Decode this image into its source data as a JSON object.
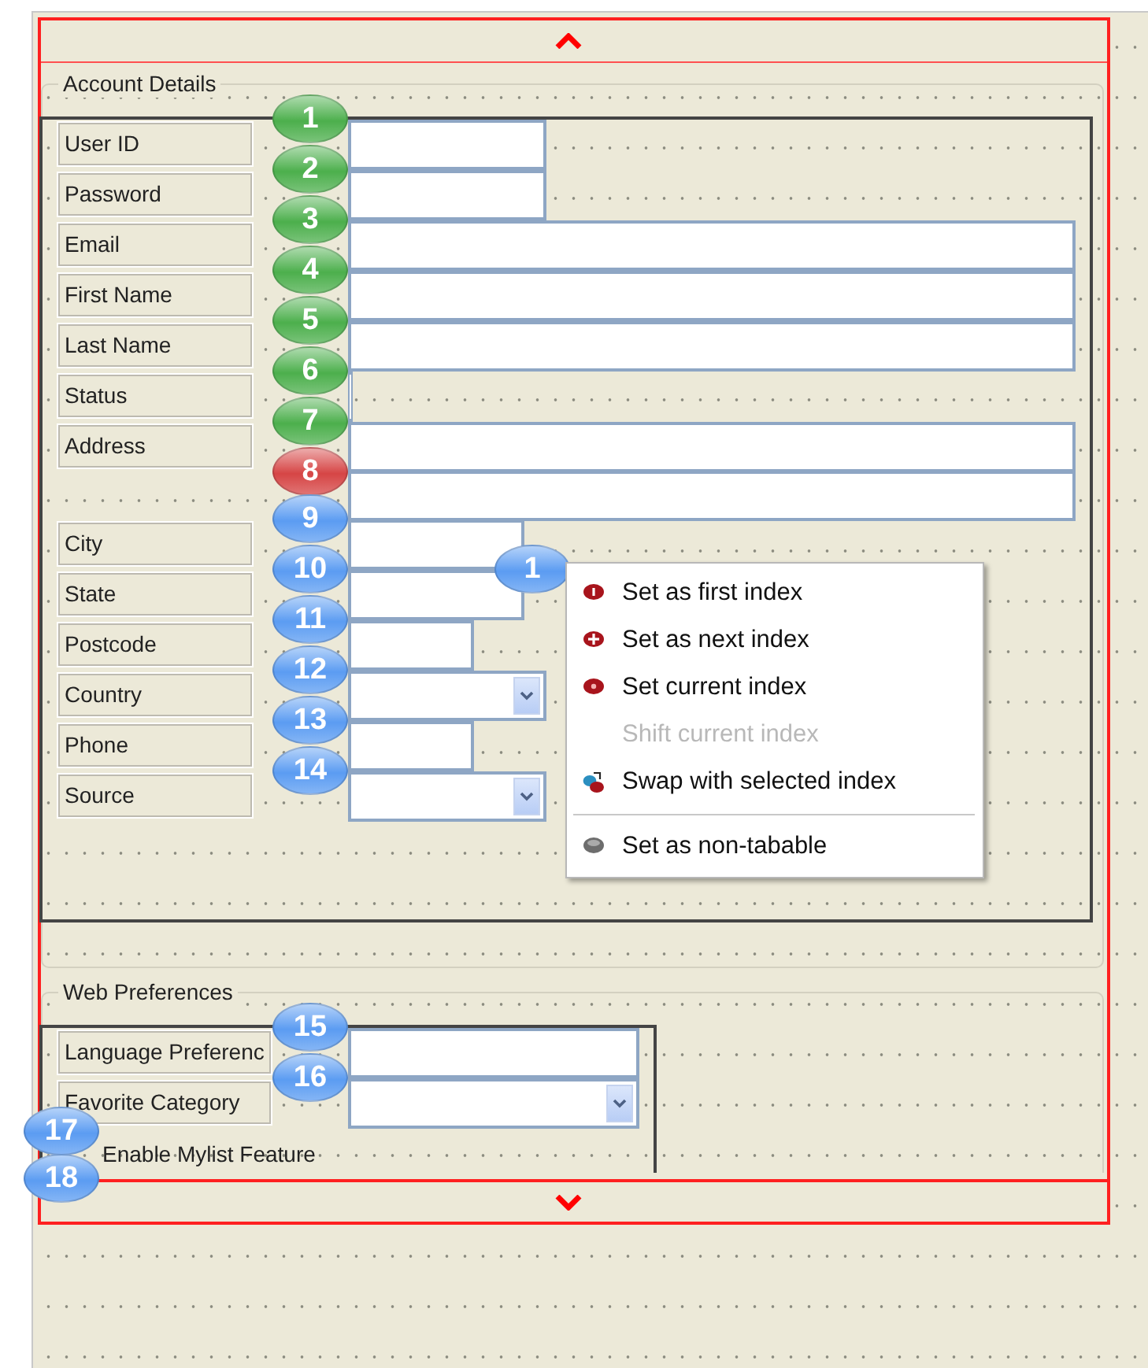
{
  "design_canvas": {
    "groups": [
      {
        "title": "Account Details",
        "rows": [
          {
            "label": "User ID",
            "fields": [
              {
                "kind": "short",
                "badge": {
                  "number": "1",
                  "color": "#4caf4c"
                }
              }
            ]
          },
          {
            "label": "Password",
            "fields": [
              {
                "kind": "short",
                "badge": {
                  "number": "2",
                  "color": "#4caf4c"
                }
              }
            ]
          },
          {
            "label": "Email",
            "fields": [
              {
                "kind": "long",
                "badge": {
                  "number": "3",
                  "color": "#4caf4c"
                }
              }
            ]
          },
          {
            "label": "First Name",
            "fields": [
              {
                "kind": "long",
                "badge": {
                  "number": "4",
                  "color": "#4caf4c"
                }
              }
            ]
          },
          {
            "label": "Last Name",
            "fields": [
              {
                "kind": "long",
                "badge": {
                  "number": "5",
                  "color": "#4caf4c"
                }
              }
            ]
          },
          {
            "label": "Status",
            "fields": [
              {
                "kind": "stub",
                "badge": {
                  "number": "6",
                  "color": "#4caf4c"
                }
              }
            ]
          },
          {
            "label": "Address",
            "fields": [
              {
                "kind": "long",
                "badge": {
                  "number": "7",
                  "color": "#4caf4c"
                }
              },
              {
                "kind": "long",
                "badge": {
                  "number": "8",
                  "color": "#d64545"
                }
              }
            ]
          },
          {
            "label": "City",
            "fields": [
              {
                "kind": "short",
                "badge": {
                  "number": "9",
                  "color": "#5b9cf2"
                }
              }
            ]
          },
          {
            "label": "State",
            "fields": [
              {
                "kind": "short",
                "badge": {
                  "number": "10",
                  "color": "#5b9cf2"
                }
              }
            ],
            "covered_badge": {
              "number": "1",
              "color": "#5b9cf2"
            }
          },
          {
            "label": "Postcode",
            "fields": [
              {
                "kind": "medium",
                "badge": {
                  "number": "11",
                  "color": "#5b9cf2"
                }
              }
            ]
          },
          {
            "label": "Country",
            "fields": [
              {
                "kind": "dropdown",
                "badge": {
                  "number": "12",
                  "color": "#5b9cf2"
                }
              }
            ]
          },
          {
            "label": "Phone",
            "fields": [
              {
                "kind": "medium",
                "badge": {
                  "number": "13",
                  "color": "#5b9cf2"
                }
              }
            ]
          },
          {
            "label": "Source",
            "fields": [
              {
                "kind": "dropdown",
                "badge": {
                  "number": "14",
                  "color": "#5b9cf2"
                }
              }
            ]
          }
        ]
      },
      {
        "title": "Web Preferences",
        "rows": [
          {
            "label": "Language Preferenc",
            "fields": [
              {
                "kind": "wide",
                "badge": {
                  "number": "15",
                  "color": "#5b9cf2"
                }
              }
            ]
          },
          {
            "label": "Favorite Category",
            "fields": [
              {
                "kind": "widedropdown",
                "badge": {
                  "number": "16",
                  "color": "#5b9cf2"
                }
              }
            ]
          }
        ],
        "checkbox": {
          "label": "Enable Mylist Feature",
          "badges": [
            {
              "number": "17",
              "color": "#5b9cf2"
            },
            {
              "number": "18",
              "color": "#5b9cf2"
            }
          ]
        }
      }
    ]
  },
  "context_menu": {
    "items": [
      {
        "kind": "first",
        "label": "Set as first index",
        "disabled": false
      },
      {
        "kind": "next",
        "label": "Set as next index",
        "disabled": false
      },
      {
        "kind": "current",
        "label": "Set current index",
        "disabled": false
      },
      {
        "kind": "shift",
        "label": "Shift current index",
        "disabled": true
      },
      {
        "kind": "swap",
        "label": "Swap with selected index",
        "disabled": false
      },
      {
        "kind": "separator"
      },
      {
        "kind": "nontab",
        "label": "Set as non-tabable",
        "disabled": false
      }
    ]
  }
}
